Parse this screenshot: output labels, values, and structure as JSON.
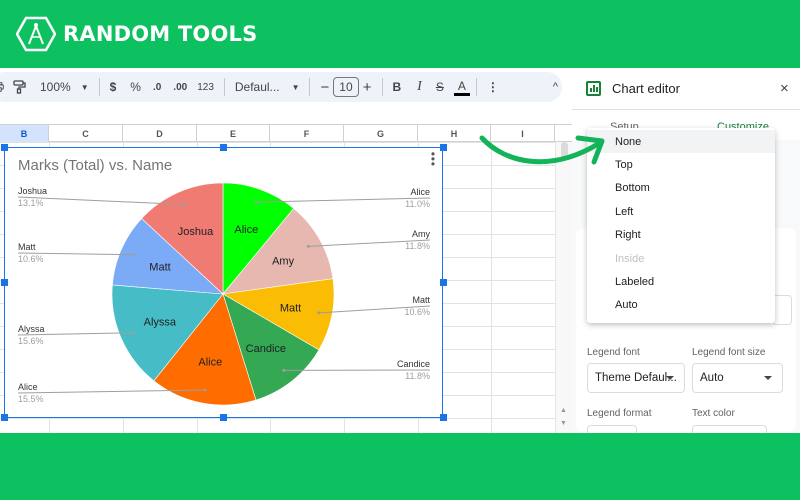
{
  "brand": {
    "name": "RANDOM TOOLS",
    "color": "#0ec160"
  },
  "toolbar": {
    "zoom": "100%",
    "currency": "$",
    "percent": "%",
    "decrease_decimal": ".0",
    "increase_decimal": ".00",
    "number_format": "123",
    "font": "Defaul...",
    "font_size": "10",
    "minus": "−",
    "plus": "+",
    "bold": "B",
    "italic": "I",
    "strikethrough": "S",
    "text_color": "A",
    "more": "⋮",
    "collapse": "^"
  },
  "columns": [
    "B",
    "C",
    "D",
    "E",
    "F",
    "G",
    "H",
    "I"
  ],
  "selected_column": "B",
  "chart_data": {
    "type": "pie",
    "title": "Marks (Total) vs. Name",
    "legend": "labeled",
    "slices": [
      {
        "label": "Alice",
        "percent": 11.0,
        "color": "#00ff00",
        "side": "right"
      },
      {
        "label": "Amy",
        "percent": 11.8,
        "color": "#e6b8af",
        "side": "right"
      },
      {
        "label": "Matt",
        "percent": 10.6,
        "color": "#fbbc04",
        "side": "right"
      },
      {
        "label": "Candice",
        "percent": 11.8,
        "color": "#34a853",
        "side": "right"
      },
      {
        "label": "Alice",
        "percent": 15.5,
        "color": "#ff6d01",
        "side": "left"
      },
      {
        "label": "Alyssa",
        "percent": 15.6,
        "color": "#46bdc6",
        "side": "left"
      },
      {
        "label": "Matt",
        "percent": 10.6,
        "color": "#7baaf7",
        "side": "left"
      },
      {
        "label": "Joshua",
        "percent": 13.1,
        "color": "#f07b72",
        "side": "left"
      }
    ]
  },
  "editor": {
    "title": "Chart editor",
    "close": "×",
    "tabs": [
      {
        "label": "Setup",
        "active": false
      },
      {
        "label": "Customize",
        "active": true
      }
    ],
    "legend_position_options": [
      {
        "label": "None",
        "highlighted": true,
        "disabled": false
      },
      {
        "label": "Top",
        "highlighted": false,
        "disabled": false
      },
      {
        "label": "Bottom",
        "highlighted": false,
        "disabled": false
      },
      {
        "label": "Left",
        "highlighted": false,
        "disabled": false
      },
      {
        "label": "Right",
        "highlighted": false,
        "disabled": false
      },
      {
        "label": "Inside",
        "highlighted": false,
        "disabled": true
      },
      {
        "label": "Labeled",
        "highlighted": false,
        "disabled": false
      },
      {
        "label": "Auto",
        "highlighted": false,
        "disabled": false
      }
    ],
    "legend_font_label": "Legend font",
    "legend_font_value": "Theme Defaul...",
    "legend_font_size_label": "Legend font size",
    "legend_font_size_value": "Auto",
    "legend_format_label": "Legend format",
    "text_color_label": "Text color"
  },
  "annotation": {
    "arrow_color": "#13b35a"
  }
}
